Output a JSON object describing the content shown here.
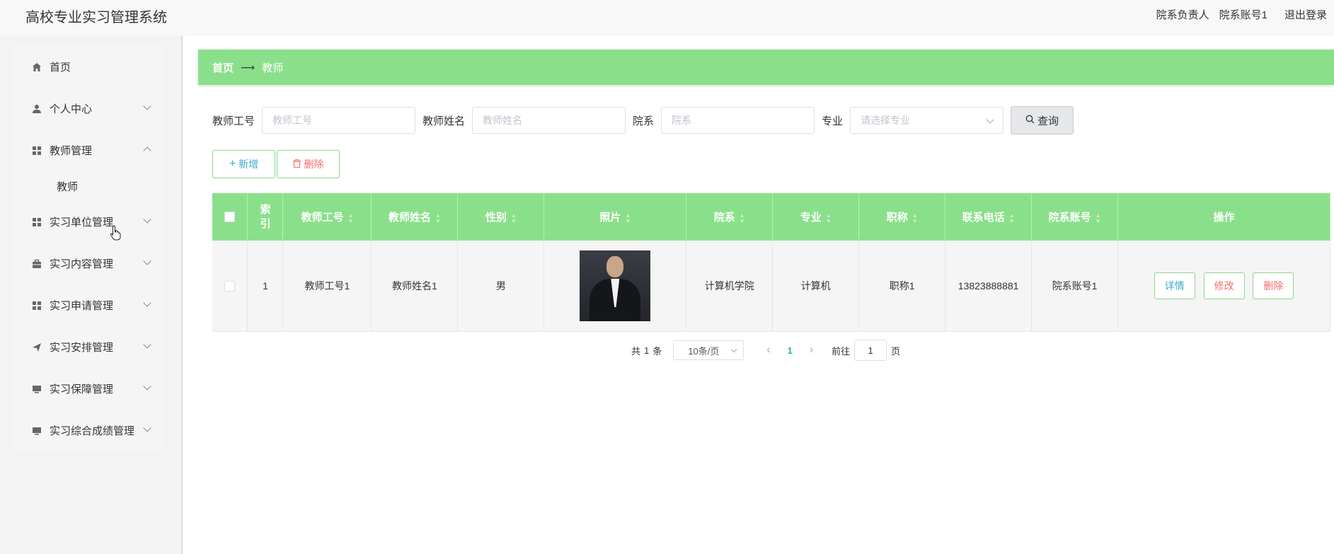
{
  "header": {
    "title": "高校专业实习管理系统",
    "role": "院系负责人",
    "account": "院系账号1",
    "logout": "退出登录"
  },
  "sidebar": {
    "items": [
      {
        "label": "首页",
        "icon": "home-icon"
      },
      {
        "label": "个人中心",
        "icon": "user-icon"
      },
      {
        "label": "教师管理",
        "icon": "grid-icon"
      },
      {
        "label": "教师",
        "icon": ""
      },
      {
        "label": "实习单位管理",
        "icon": "grid-icon"
      },
      {
        "label": "实习内容管理",
        "icon": "briefcase-icon"
      },
      {
        "label": "实习申请管理",
        "icon": "grid-icon"
      },
      {
        "label": "实习安排管理",
        "icon": "send-icon"
      },
      {
        "label": "实习保障管理",
        "icon": "monitor-icon"
      },
      {
        "label": "实习综合成绩管理",
        "icon": "monitor-icon"
      }
    ]
  },
  "breadcrumb": {
    "home": "首页",
    "current": "教师"
  },
  "search": {
    "teacher_no_label": "教师工号",
    "teacher_no_placeholder": "教师工号",
    "teacher_name_label": "教师姓名",
    "teacher_name_placeholder": "教师姓名",
    "dept_label": "院系",
    "dept_placeholder": "院系",
    "major_label": "专业",
    "major_placeholder": "请选择专业",
    "query_button": "查询"
  },
  "actions": {
    "add": "新增",
    "delete": "删除"
  },
  "table": {
    "headers": [
      "索引",
      "教师工号",
      "教师姓名",
      "性别",
      "照片",
      "院系",
      "专业",
      "职称",
      "联系电话",
      "院系账号",
      "操作"
    ],
    "rows": [
      {
        "index": "1",
        "teacher_no": "教师工号1",
        "teacher_name": "教师姓名1",
        "gender": "男",
        "dept": "计算机学院",
        "major": "计算机",
        "title": "职称1",
        "phone": "13823888881",
        "account": "院系账号1",
        "btn_detail": "详情",
        "btn_edit": "修改",
        "btn_delete": "删除"
      }
    ]
  },
  "pagination": {
    "total_prefix": "共",
    "total": "1",
    "total_suffix": "条",
    "page_size": "10条/页",
    "current": "1",
    "goto_prefix": "前往",
    "goto_value": "1",
    "goto_suffix": "页"
  },
  "colors": {
    "accent": "#8ae08a",
    "danger": "#f56c6c",
    "info": "#3ca9c9"
  }
}
